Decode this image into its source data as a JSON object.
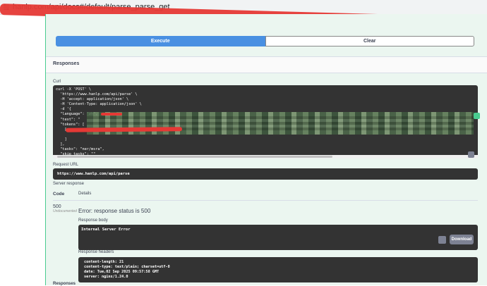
{
  "browser": {
    "url": "hanlp.com/api/docs#/default/parse_parse_get"
  },
  "actions": {
    "execute_label": "Execute",
    "clear_label": "Clear"
  },
  "responses": {
    "title": "Responses",
    "curl_label": "Curl",
    "curl_lines": [
      "curl -X 'POST' \\",
      "  'https://www.hanlp.com/api/parse' \\",
      "  -H 'accept: application/json' \\",
      "  -H 'Content-Type: application/json' \\",
      "  -d '{",
      "  \"language\": \"zh\",",
      "  \"text\": \"",
      "  \"tokens\": [",
      "    [",
      "      ",
      "    ]",
      "  ],",
      "  \"tasks\": \"ner/msra\",",
      "  \"skip_tasks\": \"\"",
      "}'"
    ],
    "request_url_label": "Request URL",
    "request_url": "https://www.hanlp.com/api/parse",
    "server_response_label": "Server response",
    "col_code": "Code",
    "col_details": "Details",
    "status_code": "500",
    "undocumented_label": "Undocumented",
    "error_title": "Error: response status is 500",
    "response_body_label": "Response body",
    "response_body": "Internal Server Error",
    "download_label": "Download",
    "response_headers_label": "Response headers",
    "response_headers": [
      "content-length: 21",
      "content-type: text/plain; charset=utf-8",
      "date: Tue,02 Sep 2025 09:57:58 GMT",
      "server: nginx/1.24.0"
    ],
    "footer_label": "Responses"
  },
  "colors": {
    "execute": "#4990e2",
    "panel_bg": "#ebf6f0",
    "code_bg": "#333333",
    "redaction": "#e53935"
  }
}
